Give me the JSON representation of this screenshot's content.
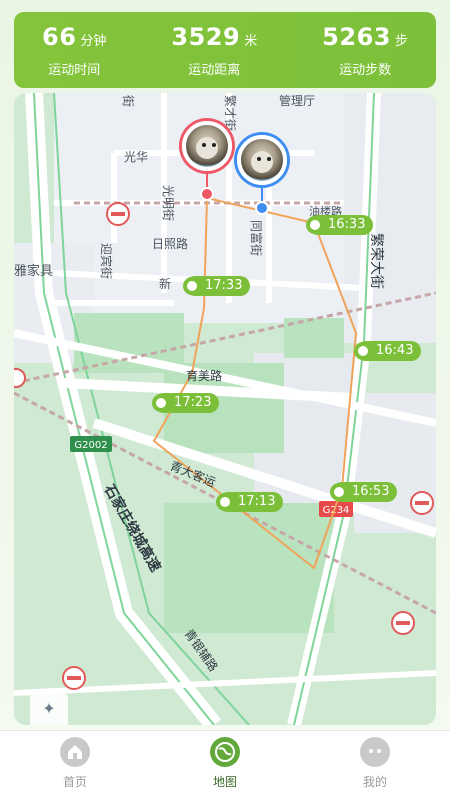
{
  "stats": {
    "time": {
      "value": "66",
      "unit": "分钟",
      "label": "运动时间"
    },
    "distance": {
      "value": "3529",
      "unit": "米",
      "label": "运动距离"
    },
    "steps": {
      "value": "5263",
      "unit": "步",
      "label": "运动步数"
    }
  },
  "map": {
    "labels": {
      "guanliting": "管理厅",
      "fancai": "繁才街",
      "guanghua": "光华",
      "guangming": "光明街",
      "tongfu": "同富街",
      "youlou": "油楼路",
      "fanrong": "繁荣大街",
      "yingbin": "迎宾街",
      "rizhao": "日照路",
      "xin": "新",
      "yajia": "雅家具",
      "yumei": "育美路",
      "qingdaike": "青大客运",
      "g2002": "G2002",
      "g234": "G234",
      "sjzhuan": "石家庄绕城高速",
      "qingyin": "青银辅路",
      "jie": "街"
    },
    "time_tags": [
      "16:33",
      "17:33",
      "16:43",
      "17:23",
      "16:53",
      "17:13"
    ]
  },
  "tabs": [
    {
      "label": "首页",
      "icon": "home-icon"
    },
    {
      "label": "地图",
      "icon": "globe-icon"
    },
    {
      "label": "我的",
      "icon": "face-icon"
    }
  ],
  "colors": {
    "accent": "#7cc03a",
    "route": "#f0a35a",
    "start_pin": "#ef5866",
    "end_pin": "#3d8df2"
  }
}
